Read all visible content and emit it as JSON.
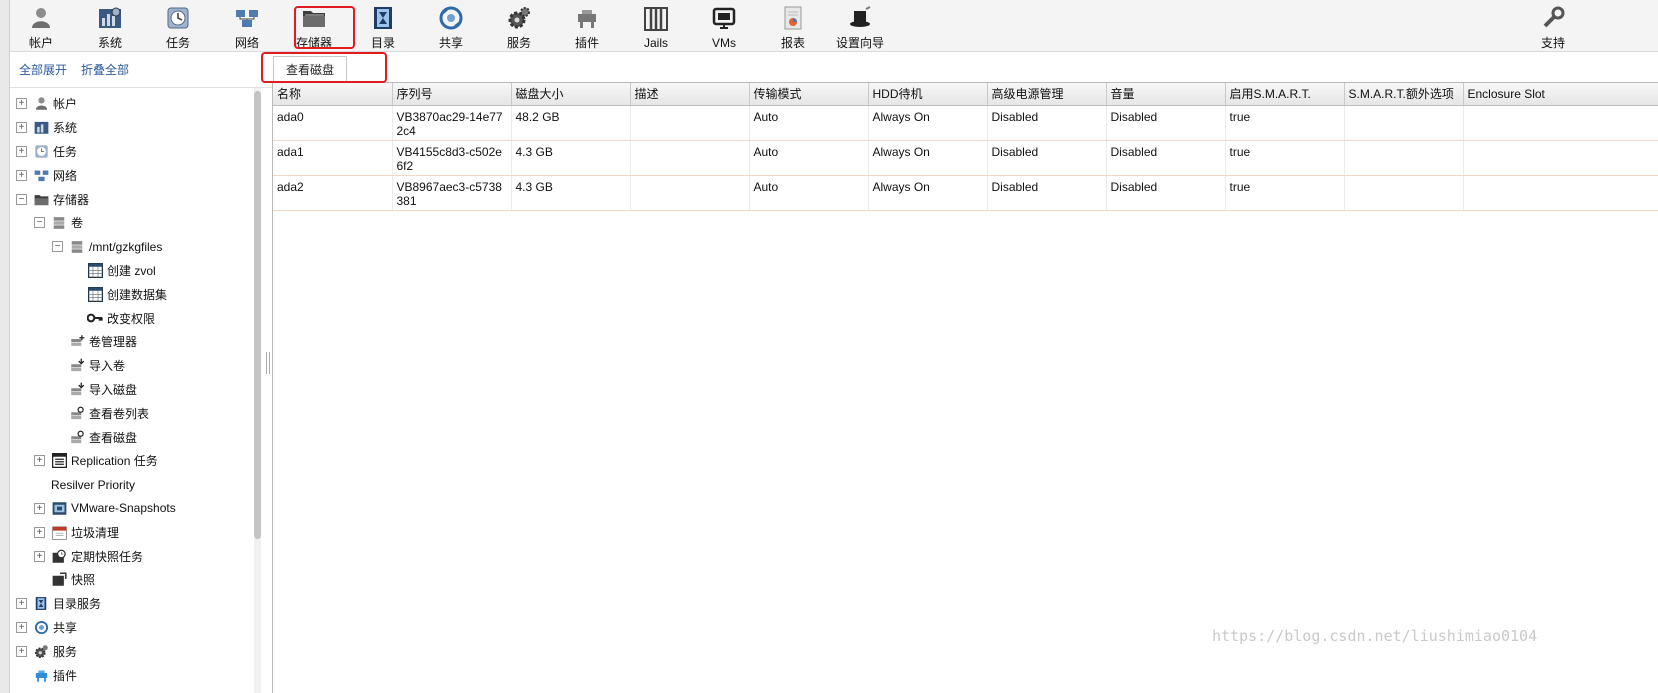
{
  "toolbar": {
    "items": [
      {
        "label": "帐户",
        "icon": "user-icon"
      },
      {
        "label": "系统",
        "icon": "system-icon"
      },
      {
        "label": "任务",
        "icon": "clock-icon"
      },
      {
        "label": "网络",
        "icon": "network-icon"
      },
      {
        "label": "存储器",
        "icon": "folder-icon"
      },
      {
        "label": "目录",
        "icon": "directory-icon"
      },
      {
        "label": "共享",
        "icon": "share-icon"
      },
      {
        "label": "服务",
        "icon": "gear-icon"
      },
      {
        "label": "插件",
        "icon": "plugin-icon"
      },
      {
        "label": "Jails",
        "icon": "jail-icon"
      },
      {
        "label": "VMs",
        "icon": "monitor-icon"
      },
      {
        "label": "报表",
        "icon": "report-icon"
      },
      {
        "label": "设置向导",
        "icon": "wizard-hat-icon"
      },
      {
        "label": "支持",
        "icon": "support-icon"
      }
    ]
  },
  "sidebar": {
    "expand_all": "全部展开",
    "collapse_all": "折叠全部",
    "tree": [
      {
        "label": "帐户",
        "toggle": "+",
        "icon": "user-icon"
      },
      {
        "label": "系统",
        "toggle": "+",
        "icon": "system-icon"
      },
      {
        "label": "任务",
        "toggle": "+",
        "icon": "clock-icon"
      },
      {
        "label": "网络",
        "toggle": "+",
        "icon": "network-icon"
      },
      {
        "label": "存储器",
        "toggle": "−",
        "icon": "folder-icon"
      },
      {
        "label": "卷",
        "toggle": "−",
        "icon": "volume-icon"
      },
      {
        "label": "/mnt/gzkgfiles",
        "toggle": "−",
        "icon": "volume-icon"
      },
      {
        "label": "创建 zvol",
        "toggle": "",
        "icon": "grid-icon"
      },
      {
        "label": "创建数据集",
        "toggle": "",
        "icon": "grid-icon"
      },
      {
        "label": "改变权限",
        "toggle": "",
        "icon": "key-icon"
      },
      {
        "label": "卷管理器",
        "toggle": "",
        "icon": "volume-manager-icon"
      },
      {
        "label": "导入卷",
        "toggle": "",
        "icon": "import-volume-icon"
      },
      {
        "label": "导入磁盘",
        "toggle": "",
        "icon": "import-disk-icon"
      },
      {
        "label": "查看卷列表",
        "toggle": "",
        "icon": "view-volumes-icon"
      },
      {
        "label": "查看磁盘",
        "toggle": "",
        "icon": "view-disks-icon"
      },
      {
        "label": "Replication 任务",
        "toggle": "+",
        "icon": "replication-icon"
      },
      {
        "label": "Resilver Priority",
        "toggle": "",
        "icon": ""
      },
      {
        "label": "VMware-Snapshots",
        "toggle": "+",
        "icon": "vmware-icon"
      },
      {
        "label": "垃圾清理",
        "toggle": "+",
        "icon": "calendar-icon"
      },
      {
        "label": "定期快照任务",
        "toggle": "+",
        "icon": "periodic-snapshot-icon"
      },
      {
        "label": "快照",
        "toggle": "",
        "icon": "snapshot-icon"
      },
      {
        "label": "目录服务",
        "toggle": "+",
        "icon": "directory-icon"
      },
      {
        "label": "共享",
        "toggle": "+",
        "icon": "share-icon"
      },
      {
        "label": "服务",
        "toggle": "+",
        "icon": "gear-icon"
      },
      {
        "label": "插件",
        "toggle": "",
        "icon": "plugin-icon"
      }
    ]
  },
  "main": {
    "tab_label": "查看磁盘",
    "columns": [
      "名称",
      "序列号",
      "磁盘大小",
      "描述",
      "传输模式",
      "HDD待机",
      "高级电源管理",
      "音量",
      "启用S.M.A.R.T.",
      "S.M.A.R.T.额外选项",
      "Enclosure Slot"
    ],
    "rows": [
      [
        "ada0",
        "VB3870ac29-14e772c4",
        "48.2 GB",
        "",
        "Auto",
        "Always On",
        "Disabled",
        "Disabled",
        "true",
        "",
        ""
      ],
      [
        "ada1",
        "VB4155c8d3-c502e6f2",
        "4.3 GB",
        "",
        "Auto",
        "Always On",
        "Disabled",
        "Disabled",
        "true",
        "",
        ""
      ],
      [
        "ada2",
        "VB8967aec3-c5738381",
        "4.3 GB",
        "",
        "Auto",
        "Always On",
        "Disabled",
        "Disabled",
        "true",
        "",
        ""
      ]
    ]
  },
  "watermark": "https://blog.csdn.net/liushimiao0104"
}
